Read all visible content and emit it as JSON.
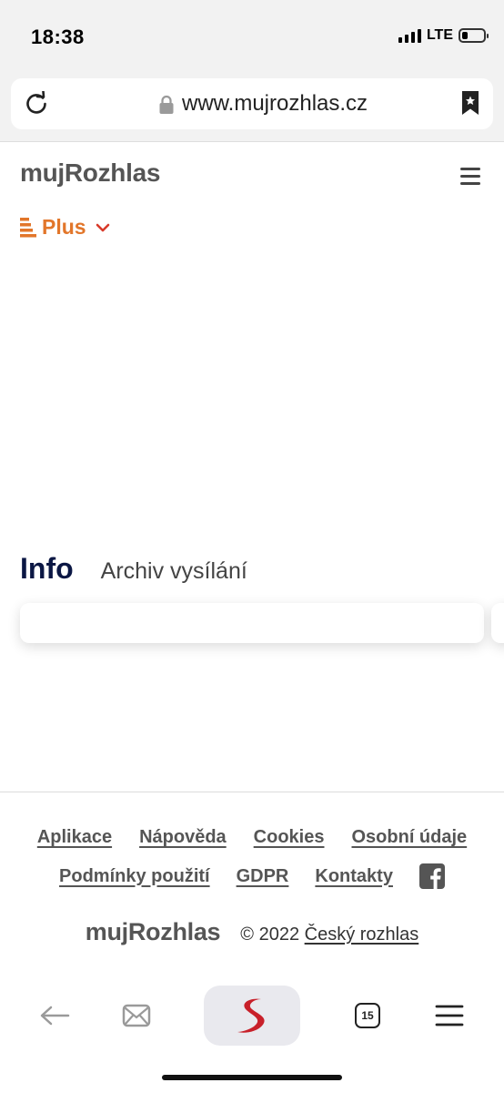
{
  "status_bar": {
    "time": "18:38",
    "network": "LTE",
    "battery_level": 0.25
  },
  "browser": {
    "url": "www.mujrozhlas.cz"
  },
  "header": {
    "logo": "mujRozhlas",
    "station": "Plus",
    "accent_color": "#e2762a"
  },
  "tabs": {
    "info": "Info",
    "archive": "Archiv vysílání"
  },
  "footer": {
    "links_row_1": [
      "Aplikace",
      "Nápověda",
      "Cookies",
      "Osobní údaje"
    ],
    "links_row_2": [
      "Podmínky použití",
      "GDPR",
      "Kontakty"
    ],
    "logo": "mujRozhlas",
    "copyright_prefix": "© 2022",
    "copyright_owner": "Český rozhlas"
  },
  "toolbar": {
    "tabs_count": "15"
  },
  "icons": {
    "reload": "reload-icon",
    "lock": "lock-icon",
    "bookmark": "bookmark-icon",
    "menu": "hamburger-menu-icon",
    "station": "plus-station-icon",
    "chevron": "chevron-down-icon",
    "facebook": "facebook-icon",
    "back": "back-arrow-icon",
    "mail": "mail-icon",
    "home": "browser-logo-icon",
    "tabs": "tabs-icon",
    "browser_menu": "browser-menu-icon"
  }
}
